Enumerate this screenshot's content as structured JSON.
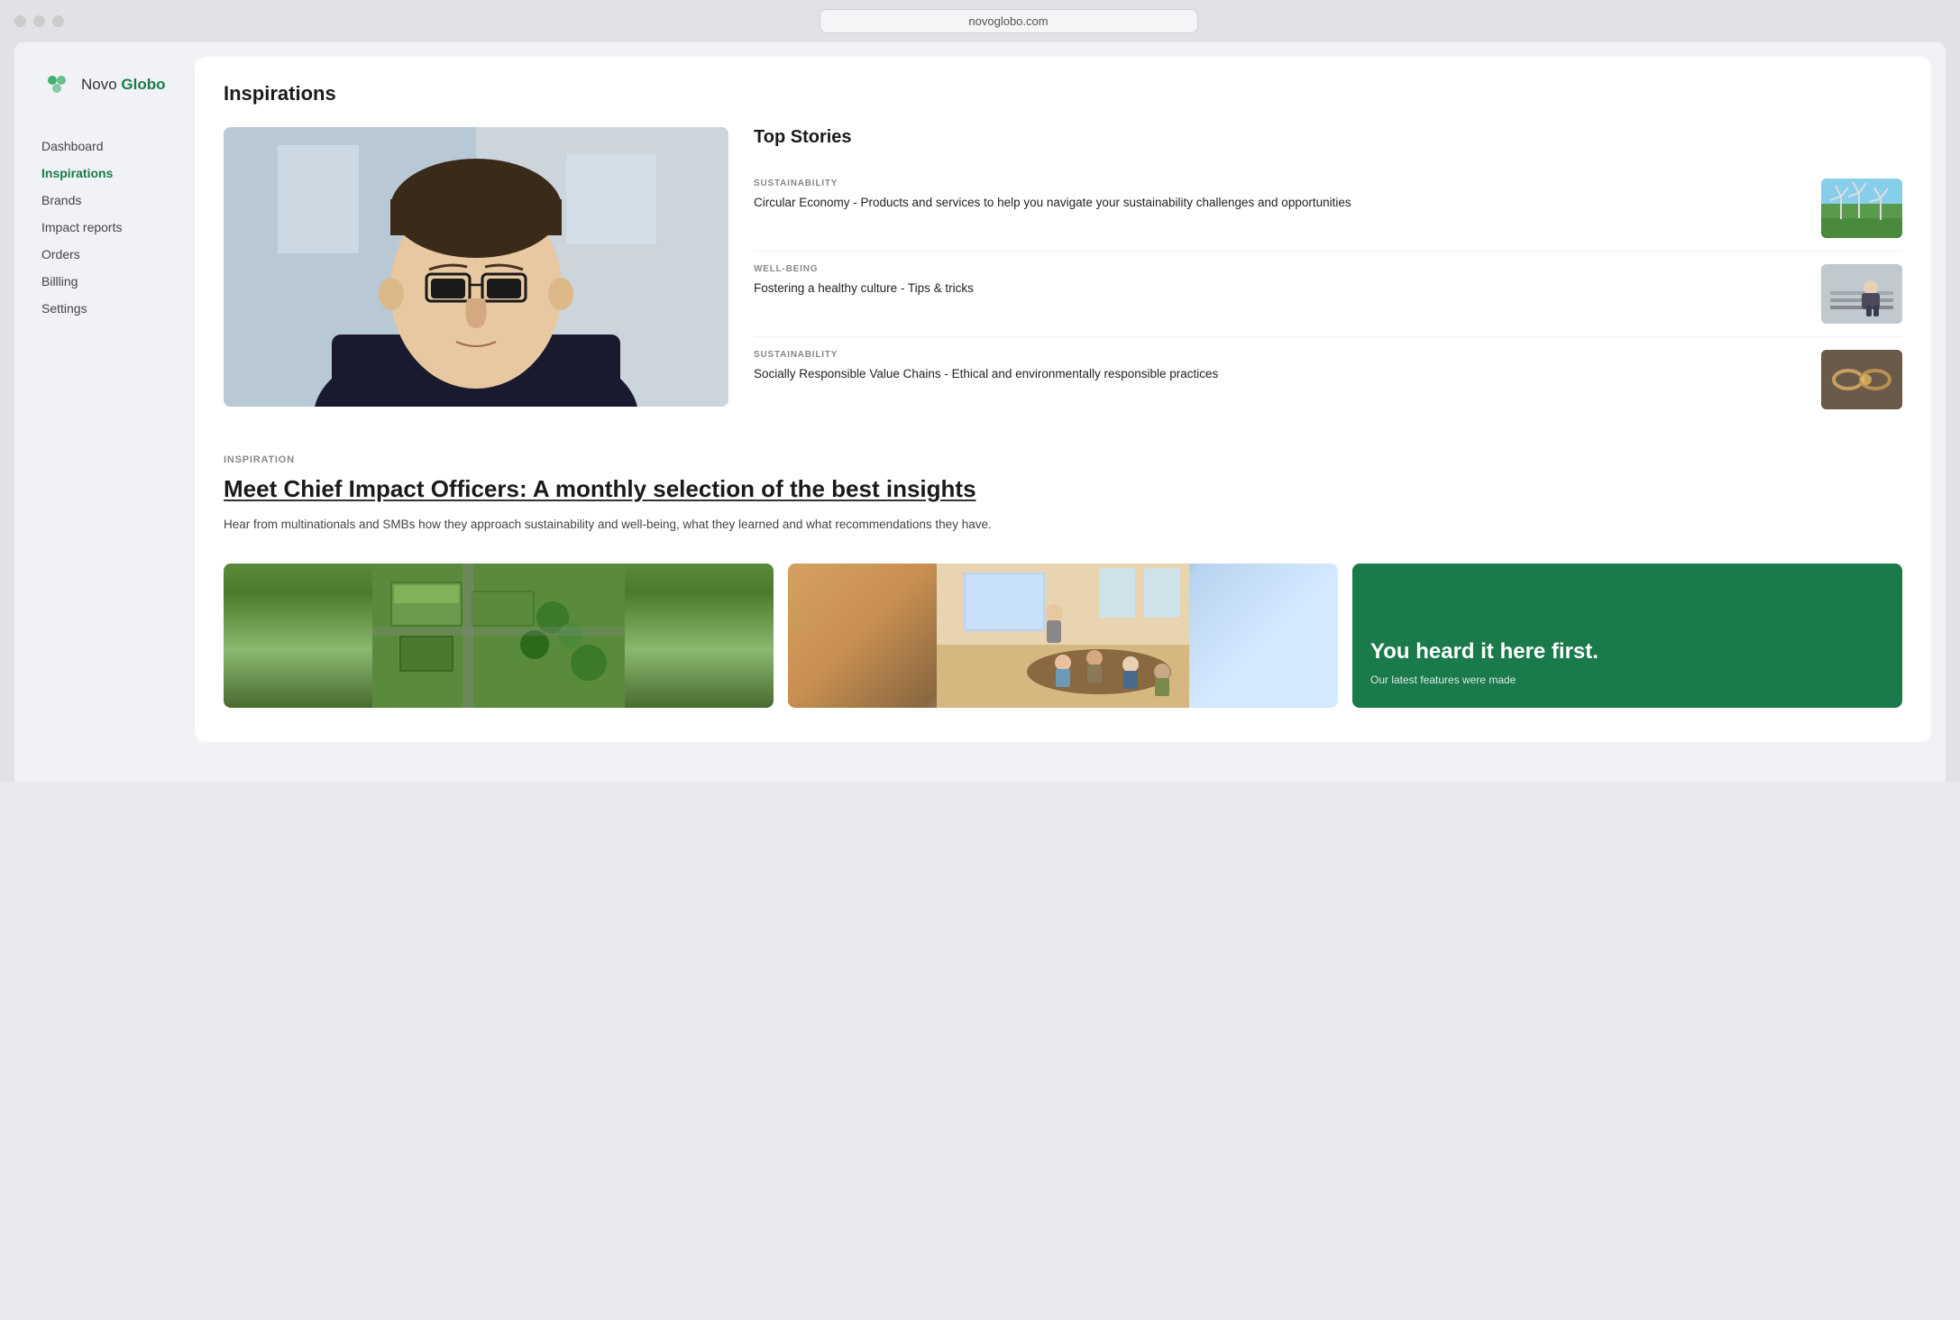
{
  "browser": {
    "url": "novoglobo.com",
    "dots": [
      "dot1",
      "dot2",
      "dot3"
    ]
  },
  "logo": {
    "text_plain": "Novo ",
    "text_bold": "Globo"
  },
  "nav": {
    "items": [
      {
        "id": "dashboard",
        "label": "Dashboard",
        "active": false
      },
      {
        "id": "inspirations",
        "label": "Inspirations",
        "active": true
      },
      {
        "id": "brands",
        "label": "Brands",
        "active": false
      },
      {
        "id": "impact-reports",
        "label": "Impact reports",
        "active": false
      },
      {
        "id": "orders",
        "label": "Orders",
        "active": false
      },
      {
        "id": "billing",
        "label": "Billling",
        "active": false
      },
      {
        "id": "settings",
        "label": "Settings",
        "active": false
      }
    ]
  },
  "page": {
    "title": "Inspirations"
  },
  "top_stories": {
    "heading": "Top Stories",
    "items": [
      {
        "category": "SUSTAINABILITY",
        "text": "Circular Economy - Products and services to help you navigate your sustainability challenges and opportunities",
        "thumb_type": "windmills"
      },
      {
        "category": "WELL-BEING",
        "text": "Fostering a healthy culture - Tips & tricks",
        "thumb_type": "person"
      },
      {
        "category": "SUSTAINABILITY",
        "text": "Socially Responsible Value Chains - Ethical and environmentally responsible practices",
        "thumb_type": "chains"
      }
    ]
  },
  "featured_article": {
    "tag": "INSPIRATION",
    "title": "Meet Chief Impact Officers: A monthly selection of the best insights",
    "description": "Hear from multinationals and SMBs how they approach sustainability and well-being, what they learned and what recommendations they have."
  },
  "bottom_cards": {
    "green_card": {
      "headline": "You heard it here first.",
      "subtext": "Our latest features were made"
    }
  }
}
